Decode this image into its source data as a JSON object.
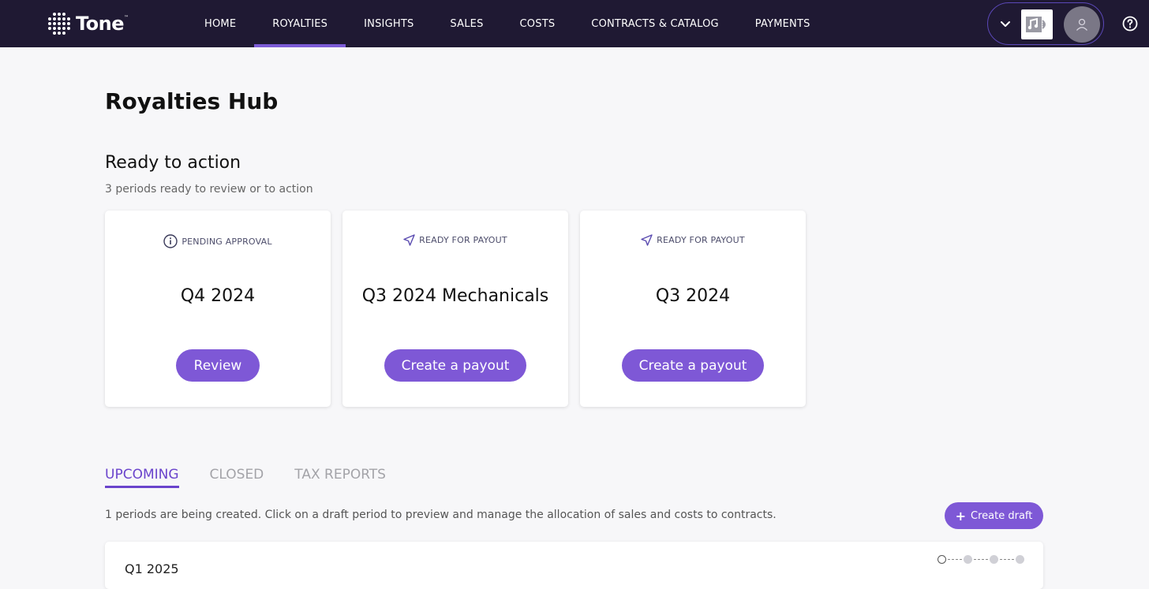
{
  "brand": {
    "name": "Tone",
    "trademark": "™"
  },
  "nav": {
    "items": [
      {
        "label": "HOME",
        "active": false
      },
      {
        "label": "ROYALTIES",
        "active": true
      },
      {
        "label": "INSIGHTS",
        "active": false
      },
      {
        "label": "SALES",
        "active": false
      },
      {
        "label": "COSTS",
        "active": false
      },
      {
        "label": "CONTRACTS & CATALOG",
        "active": false
      },
      {
        "label": "PAYMENTS",
        "active": false
      }
    ]
  },
  "header_icons": [
    "chevron-down-icon",
    "music-label-logo",
    "user-icon",
    "help-icon"
  ],
  "page": {
    "title": "Royalties Hub",
    "ready": {
      "title": "Ready to action",
      "subtitle": "3 periods ready to review or to action",
      "cards": [
        {
          "status": "PENDING APPROVAL",
          "status_icon": "info-icon",
          "title": "Q4 2024",
          "button": "Review"
        },
        {
          "status": "READY FOR PAYOUT",
          "status_icon": "send-icon",
          "title": "Q3 2024 Mechanicals",
          "button": "Create a payout"
        },
        {
          "status": "READY FOR PAYOUT",
          "status_icon": "send-icon",
          "title": "Q3 2024",
          "button": "Create a payout"
        }
      ]
    },
    "tabs": [
      {
        "label": "UPCOMING",
        "active": true
      },
      {
        "label": "CLOSED",
        "active": false
      },
      {
        "label": "TAX REPORTS",
        "active": false
      }
    ],
    "upcoming": {
      "description": "1 periods are being created. Click on a draft period to preview and manage the allocation of sales and costs to contracts.",
      "create_button": "Create draft",
      "period_label": "Q1 2025"
    }
  },
  "colors": {
    "nav_bg": "#1f1933",
    "accent": "#7e58d6",
    "tab_active": "#6a44cc"
  }
}
